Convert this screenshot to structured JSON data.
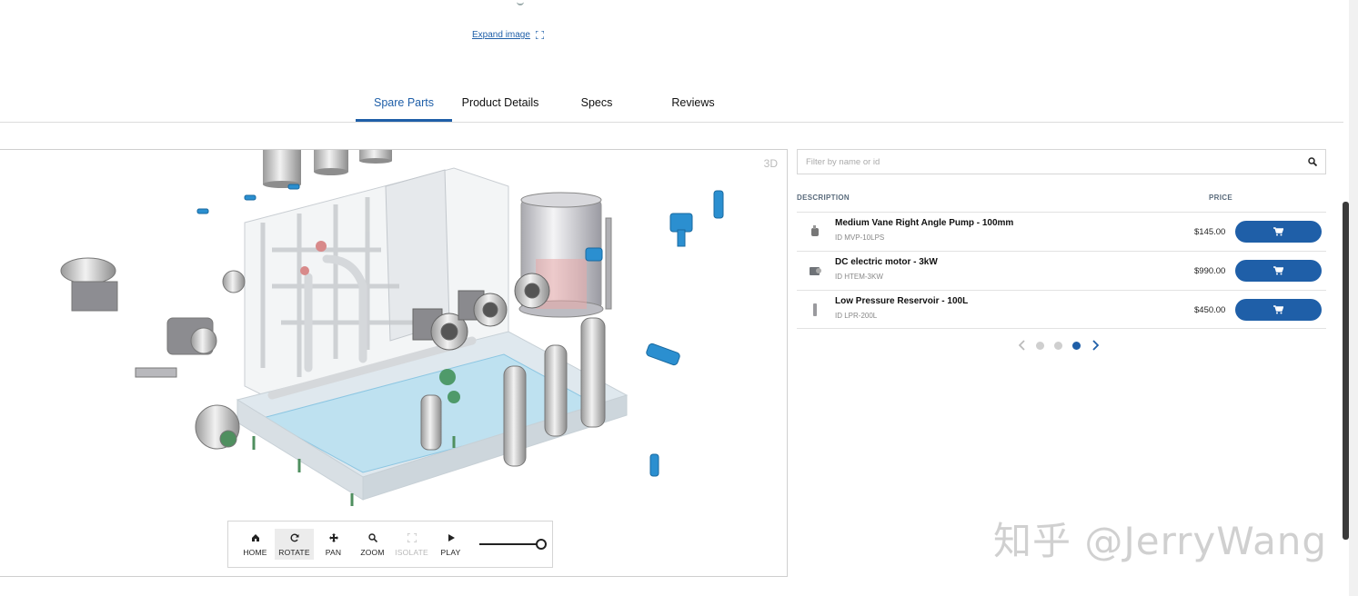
{
  "expand": {
    "label": "Expand image"
  },
  "tabs": [
    {
      "label": "Spare Parts",
      "active": true
    },
    {
      "label": "Product Details",
      "active": false
    },
    {
      "label": "Specs",
      "active": false
    },
    {
      "label": "Reviews",
      "active": false
    }
  ],
  "viewer": {
    "badge": "3D",
    "toolbar": [
      {
        "label": "HOME",
        "icon": "home-icon",
        "state": "normal"
      },
      {
        "label": "ROTATE",
        "icon": "rotate-icon",
        "state": "active"
      },
      {
        "label": "PAN",
        "icon": "pan-icon",
        "state": "normal"
      },
      {
        "label": "ZOOM",
        "icon": "zoom-icon",
        "state": "normal"
      },
      {
        "label": "ISOLATE",
        "icon": "isolate-icon",
        "state": "disabled"
      },
      {
        "label": "PLAY",
        "icon": "play-icon",
        "state": "normal"
      }
    ],
    "slider_value": 1.0
  },
  "parts": {
    "search_placeholder": "Filter by name or id",
    "header": {
      "description": "DESCRIPTION",
      "price": "PRICE"
    },
    "rows": [
      {
        "name": "Medium Vane Right Angle Pump - 100mm",
        "id": "ID MVP-10LPS",
        "price": "$145.00"
      },
      {
        "name": "DC electric motor - 3kW",
        "id": "ID HTEM-3KW",
        "price": "$990.00"
      },
      {
        "name": "Low Pressure Reservoir - 100L",
        "id": "ID LPR-200L",
        "price": "$450.00"
      }
    ],
    "pager": {
      "pages": 3,
      "current": 3
    }
  },
  "colors": {
    "accent": "#1f5fa8",
    "model_blue": "#2b8fd0",
    "glass": "#b9dff0"
  },
  "watermark": "知乎 @JerryWang"
}
